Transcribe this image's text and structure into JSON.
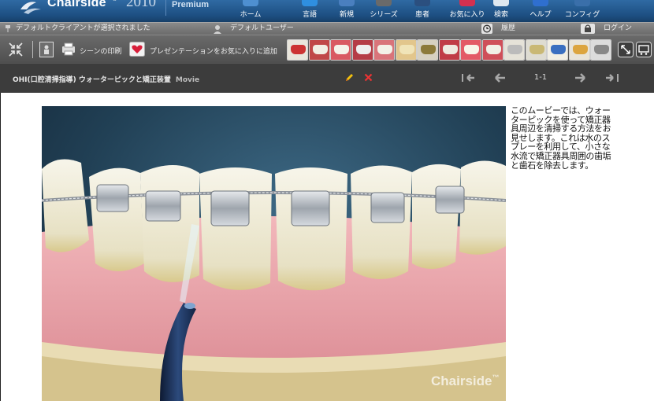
{
  "app": {
    "brand": "Chairside",
    "trademark": "®",
    "year": "2010",
    "edition": "Premium"
  },
  "topnav": [
    {
      "label": "ホーム",
      "icon": "home-icon"
    },
    {
      "label": "言語",
      "icon": "language-icon"
    },
    {
      "label": "新規",
      "icon": "new-icon"
    },
    {
      "label": "シリーズ",
      "icon": "series-icon"
    },
    {
      "label": "患者",
      "icon": "patient-icon"
    },
    {
      "label": "お気に入り",
      "icon": "favorites-icon"
    },
    {
      "label": "検索",
      "icon": "search-icon"
    },
    {
      "label": "ヘルプ",
      "icon": "help-icon"
    },
    {
      "label": "コンフィグ",
      "icon": "config-icon"
    }
  ],
  "status": {
    "client": "デフォルトクライアントが選択されました",
    "user": "デフォルトユーザー",
    "history": "履歴",
    "login": "ログイン"
  },
  "toolbar": {
    "print_scene": "シーンの印刷",
    "add_favorite": "プレゼンテーションをお気に入りに追加"
  },
  "titlebar": {
    "title": "OHI(口腔清掃指導) ウォーターピックと矯正装置",
    "type": "Movie",
    "pager": "1-1"
  },
  "content": {
    "description": "このムービーでは、ウォーターピックを使って矯正器具周辺を清掃する方法をお見せします。これは水のスプレーを利用して、小さな水流で矯正器具周囲の歯垢と歯石を除去します。",
    "watermark": "Chairside",
    "watermark_tm": "™"
  },
  "colors": {
    "header": "#1d4f82",
    "toolbar": "#5a5a5a",
    "titlebar": "#3c3c3c",
    "gum": "#e8a0a6",
    "tooth": "#f1efe2",
    "bracket": "#b9bec4",
    "pick": "#1c2e52"
  }
}
